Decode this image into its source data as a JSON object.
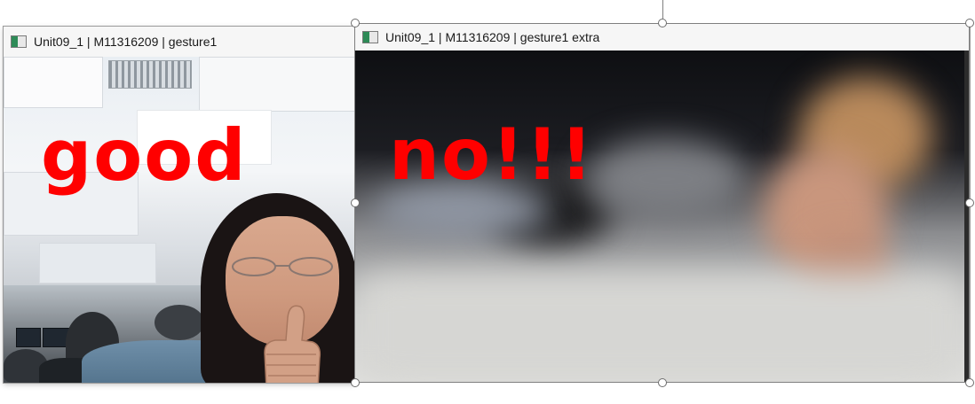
{
  "windows": [
    {
      "title": "Unit09_1 | M11316209 | gesture1",
      "overlay_text": "good"
    },
    {
      "title": "Unit09_1 | M11316209 | gesture1 extra",
      "overlay_text": "no!!!"
    }
  ],
  "colors": {
    "overlay_text": "#ff0000",
    "titlebar_bg": "#f6f6f6",
    "selection_handle_border": "#6d6d6d"
  },
  "icons": {
    "window_app_icon": "opencv-window-icon",
    "selection_handle": "resize-handle-icon"
  }
}
